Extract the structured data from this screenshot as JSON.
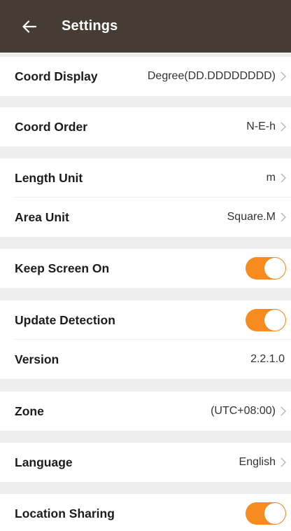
{
  "header": {
    "title": "Settings",
    "back_icon": "arrow-left-icon",
    "background_color": "#473c34"
  },
  "settings": {
    "coord_display": {
      "label": "Coord Display",
      "value": "Degree(DD.DDDDDDDD)"
    },
    "coord_order": {
      "label": "Coord Order",
      "value": "N-E-h"
    },
    "length_unit": {
      "label": "Length Unit",
      "value": "m"
    },
    "area_unit": {
      "label": "Area Unit",
      "value": "Square.M"
    },
    "keep_screen_on": {
      "label": "Keep Screen On",
      "enabled": true
    },
    "update_detection": {
      "label": "Update Detection",
      "enabled": true
    },
    "version": {
      "label": "Version",
      "value": "2.2.1.0"
    },
    "zone": {
      "label": "Zone",
      "value": "(UTC+08:00)"
    },
    "language": {
      "label": "Language",
      "value": "English"
    },
    "location_sharing": {
      "label": "Location Sharing",
      "enabled": true
    }
  },
  "colors": {
    "toggle_on": "#f78b1f",
    "section_gap": "#eeeeee",
    "chevron": "#b5b5b5"
  },
  "icons": {
    "chevron": "chevron-right-icon"
  }
}
